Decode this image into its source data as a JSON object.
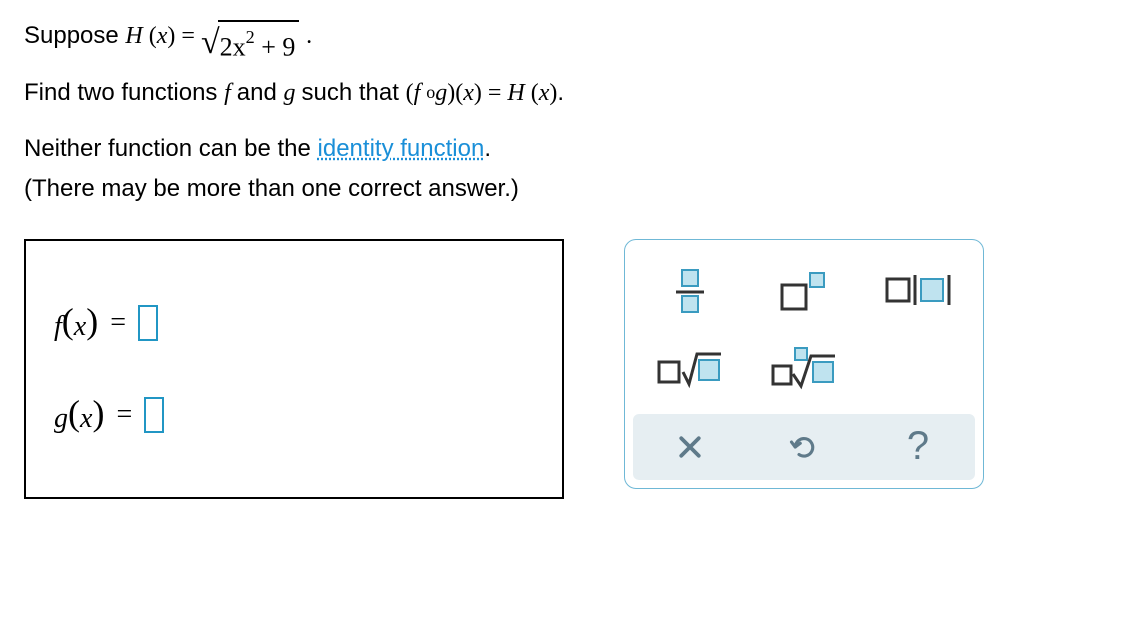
{
  "prompt": {
    "line1_prefix": "Suppose ",
    "H_def_lhs": "H (x) = ",
    "radicand": "2x",
    "radicand_exp": "2",
    "radicand_suffix": " + 9",
    "line1_suffix": ".",
    "line2_a": "Find two functions ",
    "line2_f": "f ",
    "line2_and": "and ",
    "line2_g": "g ",
    "line2_b": "such that ",
    "compose_expr": "(f ∘g)(x) = H (x)",
    "line2_suffix": ".",
    "line3a": "Neither function can be the ",
    "identity_link": "identity function",
    "line3b": ".",
    "line4": "(There may be more than one correct answer.)"
  },
  "answers": {
    "f_label": "f",
    "g_label": "g",
    "var": "x",
    "equals": "="
  },
  "palette": {
    "icons": {
      "fraction": "fraction",
      "exponent": "exponent",
      "abs": "absolute-value",
      "sqrt": "square-root",
      "nthroot": "nth-root"
    }
  }
}
